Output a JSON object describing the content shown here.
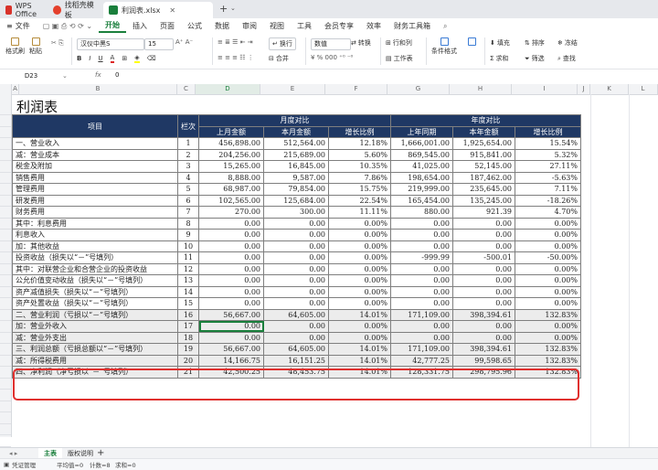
{
  "tabs": [
    {
      "label": "WPS Office",
      "color": "#d8322a"
    },
    {
      "label": "找稻壳模板",
      "color": "#e4402c"
    },
    {
      "label": "利润表.xlsx",
      "color": "#1a7f3c"
    }
  ],
  "menu": {
    "file_label": "文件",
    "items": [
      "开始",
      "插入",
      "页面",
      "公式",
      "数据",
      "审阅",
      "视图",
      "工具",
      "会员专享",
      "效率",
      "财务工具箱"
    ]
  },
  "ribbon": {
    "format_painter": "格式刷",
    "paste": "粘贴",
    "font_name": "汉仪中黑S",
    "font_size": "15",
    "wrap": "换行",
    "number_format": "数值",
    "convert": "转换",
    "row_col": "行和列",
    "merge": "合并",
    "worksheet": "工作表",
    "cond_format": "条件格式",
    "fill": "填充",
    "sort": "排序",
    "freeze": "冻结",
    "sum": "求和",
    "filter": "筛选",
    "find": "查找"
  },
  "formula_bar": {
    "cell_ref": "D23",
    "fx": "fx",
    "value": "0"
  },
  "columns": [
    "A",
    "B",
    "C",
    "D",
    "E",
    "F",
    "G",
    "H",
    "I",
    "J",
    "K",
    "L"
  ],
  "sheet": {
    "title": "利润表",
    "headers": {
      "item": "项目",
      "line": "栏次",
      "monthly": "月度对比",
      "yearly": "年度对比",
      "last_month": "上月金额",
      "this_month": "本月金额",
      "growth_m": "增长比例",
      "last_year": "上年同期",
      "this_year": "本年金额",
      "growth_y": "增长比例"
    },
    "rows": [
      {
        "item": "一、营业收入",
        "no": "1",
        "d": "456,898.00",
        "e": "512,564.00",
        "f": "12.18%",
        "g": "1,666,001.00",
        "h": "1,925,654.00",
        "i": "15.54%"
      },
      {
        "item": "减：营业成本",
        "no": "2",
        "d": "204,256.00",
        "e": "215,689.00",
        "f": "5.60%",
        "g": "869,545.00",
        "h": "915,841.00",
        "i": "5.32%"
      },
      {
        "item": "税金及附加",
        "no": "3",
        "d": "15,265.00",
        "e": "16,845.00",
        "f": "10.35%",
        "g": "41,025.00",
        "h": "52,145.00",
        "i": "27.11%"
      },
      {
        "item": "销售费用",
        "no": "4",
        "d": "8,888.00",
        "e": "9,587.00",
        "f": "7.86%",
        "g": "198,654.00",
        "h": "187,462.00",
        "i": "-5.63%"
      },
      {
        "item": "管理费用",
        "no": "5",
        "d": "68,987.00",
        "e": "79,854.00",
        "f": "15.75%",
        "g": "219,999.00",
        "h": "235,645.00",
        "i": "7.11%"
      },
      {
        "item": "研发费用",
        "no": "6",
        "d": "102,565.00",
        "e": "125,684.00",
        "f": "22.54%",
        "g": "165,454.00",
        "h": "135,245.00",
        "i": "-18.26%"
      },
      {
        "item": "财务费用",
        "no": "7",
        "d": "270.00",
        "e": "300.00",
        "f": "11.11%",
        "g": "880.00",
        "h": "921.39",
        "i": "4.70%"
      },
      {
        "item": "其中：利息费用",
        "no": "8",
        "d": "0.00",
        "e": "0.00",
        "f": "0.00%",
        "g": "0.00",
        "h": "0.00",
        "i": "0.00%"
      },
      {
        "item": "利息收入",
        "no": "9",
        "d": "0.00",
        "e": "0.00",
        "f": "0.00%",
        "g": "0.00",
        "h": "0.00",
        "i": "0.00%"
      },
      {
        "item": "加：其他收益",
        "no": "10",
        "d": "0.00",
        "e": "0.00",
        "f": "0.00%",
        "g": "0.00",
        "h": "0.00",
        "i": "0.00%"
      },
      {
        "item": "投资收益（损失以“－”号填列）",
        "no": "11",
        "d": "0.00",
        "e": "0.00",
        "f": "0.00%",
        "g": "-999.99",
        "h": "-500.01",
        "i": "-50.00%"
      },
      {
        "item": "其中：对联营企业和合营企业的投资收益",
        "no": "12",
        "d": "0.00",
        "e": "0.00",
        "f": "0.00%",
        "g": "0.00",
        "h": "0.00",
        "i": "0.00%"
      },
      {
        "item": "公允价值变动收益（损失以“－”号填列）",
        "no": "13",
        "d": "0.00",
        "e": "0.00",
        "f": "0.00%",
        "g": "0.00",
        "h": "0.00",
        "i": "0.00%"
      },
      {
        "item": "资产减值损失（损失以“－”号填列）",
        "no": "14",
        "d": "0.00",
        "e": "0.00",
        "f": "0.00%",
        "g": "0.00",
        "h": "0.00",
        "i": "0.00%"
      },
      {
        "item": "资产处置收益（损失以“－”号填列）",
        "no": "15",
        "d": "0.00",
        "e": "0.00",
        "f": "0.00%",
        "g": "0.00",
        "h": "0.00",
        "i": "0.00%"
      },
      {
        "item": "二、营业利润（亏损以“－”号填列）",
        "no": "16",
        "d": "56,667.00",
        "e": "64,605.00",
        "f": "14.01%",
        "g": "171,109.00",
        "h": "398,394.61",
        "i": "132.83%"
      },
      {
        "item": "加：营业外收入",
        "no": "17",
        "d": "0.00",
        "e": "0.00",
        "f": "0.00%",
        "g": "0.00",
        "h": "0.00",
        "i": "0.00%"
      },
      {
        "item": "减：营业外支出",
        "no": "18",
        "d": "0.00",
        "e": "0.00",
        "f": "0.00%",
        "g": "0.00",
        "h": "0.00",
        "i": "0.00%"
      },
      {
        "item": "三、利润总额（亏损总额以“－”号填列）",
        "no": "19",
        "d": "56,667.00",
        "e": "64,605.00",
        "f": "14.01%",
        "g": "171,109.00",
        "h": "398,394.61",
        "i": "132.83%"
      },
      {
        "item": "减：所得税费用",
        "no": "20",
        "d": "14,166.75",
        "e": "16,151.25",
        "f": "14.01%",
        "g": "42,777.25",
        "h": "99,598.65",
        "i": "132.83%"
      },
      {
        "item": "四、净利润（净亏损以“－”号填列）",
        "no": "21",
        "d": "42,500.25",
        "e": "48,453.75",
        "f": "14.01%",
        "g": "128,331.75",
        "h": "298,795.96",
        "i": "132.83%"
      }
    ]
  },
  "sheet_tabs": [
    "主表",
    "版权说明"
  ],
  "status": {
    "left": "凭证管理",
    "avg": "平均值=0",
    "count": "计数=8",
    "sum": "求和=0"
  },
  "colors": {
    "header_bg": "#1f3864",
    "accent": "#1a7f3c",
    "highlight": "#e0302e"
  }
}
